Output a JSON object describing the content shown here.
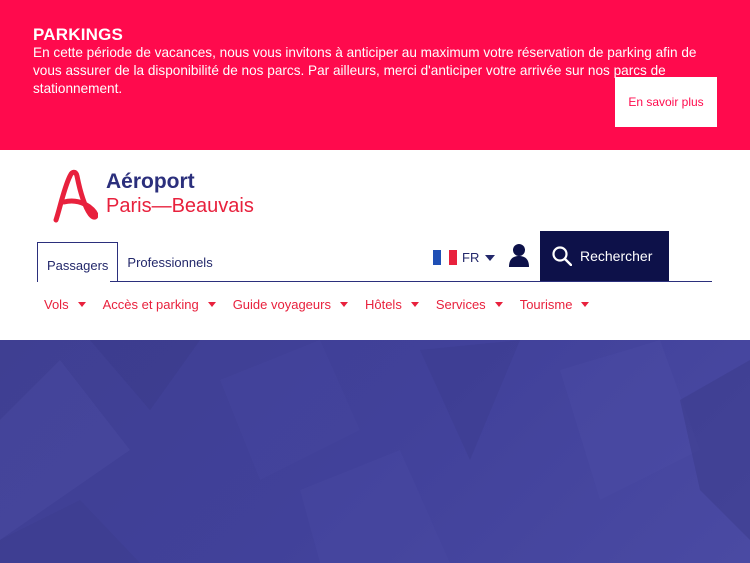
{
  "alert": {
    "title": "PARKINGS",
    "text": "En cette période de vacances, nous vous invitons à anticiper au maximum votre réservation de parking afin de vous assurer de la disponibilité de nos parcs. Par ailleurs, merci d'anticiper votre arrivée sur nos parcs de stationnement.",
    "button_label": "En savoir plus",
    "background_color": "#ff0a4d"
  },
  "logo": {
    "line1": "Aéroport",
    "line2": "Paris—Beauvais",
    "icon": "airport-logo-icon"
  },
  "audience_tabs": [
    {
      "label": "Passagers",
      "active": true
    },
    {
      "label": "Professionnels",
      "active": false
    }
  ],
  "language": {
    "code": "FR",
    "icon": "french-flag-icon"
  },
  "account": {
    "icon": "user-icon"
  },
  "search": {
    "label": "Rechercher",
    "icon": "search-icon"
  },
  "main_nav": [
    {
      "label": "Vols"
    },
    {
      "label": "Accès et parking"
    },
    {
      "label": "Guide voyageurs"
    },
    {
      "label": "Hôtels"
    },
    {
      "label": "Services"
    },
    {
      "label": "Tourisme"
    }
  ],
  "colors": {
    "brand_navy": "#2b2f7c",
    "brand_red": "#e8213d",
    "hero": "#41419a"
  }
}
